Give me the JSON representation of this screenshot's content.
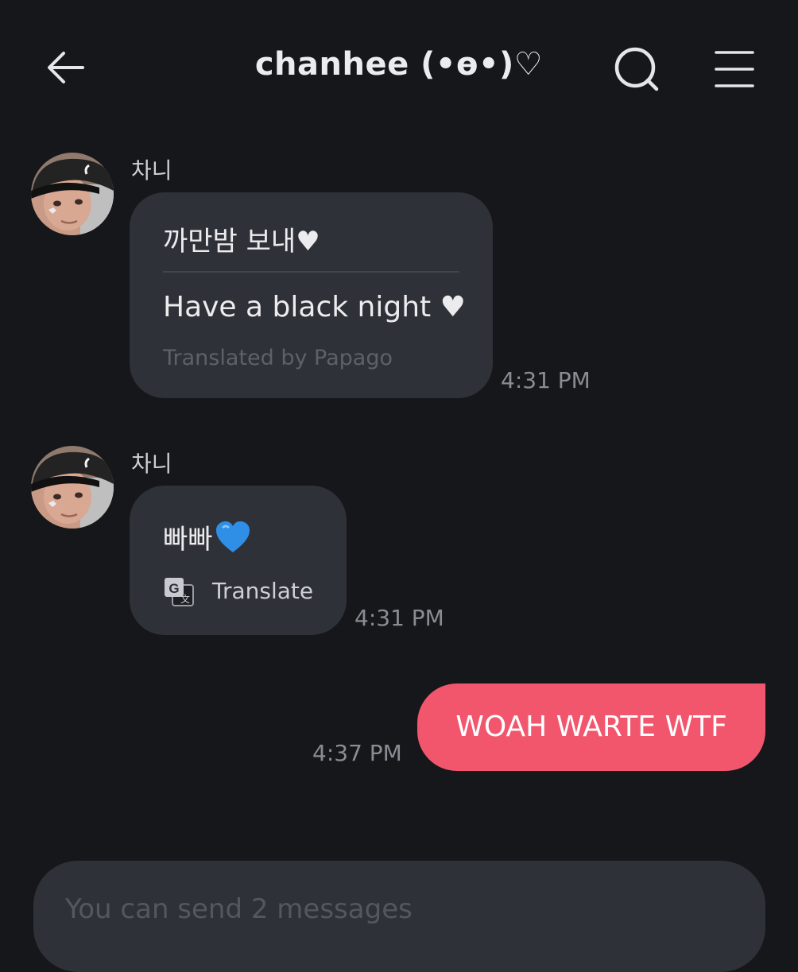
{
  "header": {
    "title": "chanhee (•ɵ•)♡"
  },
  "messages": [
    {
      "sender": "차니",
      "original": "까만밤 보내♥",
      "translation": "Have a black night ♥",
      "credit": "Translated by Papago",
      "time": "4:31 PM"
    },
    {
      "sender": "차니",
      "text": "빠빠",
      "emoji_icon": "blue-heart-icon",
      "translate_label": "Translate",
      "time": "4:31 PM"
    },
    {
      "text": "WOAH WARTE WTF",
      "time": "4:37 PM"
    }
  ],
  "composer": {
    "placeholder": "You can send 2 messages"
  },
  "colors": {
    "background": "#16171b",
    "bubble": "#2f3138",
    "outgoing_bubble": "#f2566d",
    "blue_heart": "#2f8fe6"
  }
}
